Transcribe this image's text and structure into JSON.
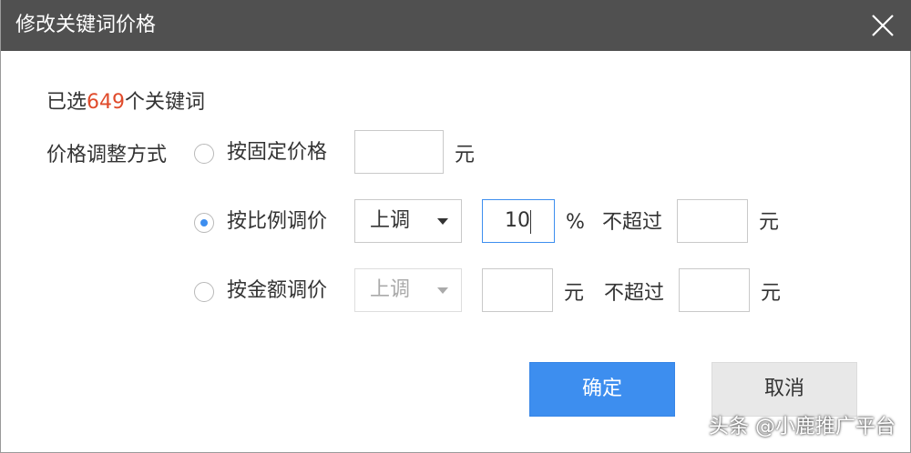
{
  "dialog": {
    "title": "修改关键词价格"
  },
  "selection": {
    "prefix": "已选",
    "count": "649",
    "suffix": "个关键词"
  },
  "method": {
    "label": "价格调整方式",
    "options": [
      {
        "label": "按固定价格",
        "selected": false,
        "value": "",
        "unit": "元"
      },
      {
        "label": "按比例调价",
        "selected": true,
        "direction": "上调",
        "value": "10",
        "unit": "%",
        "limit_label": "不超过",
        "limit_value": "",
        "limit_unit": "元"
      },
      {
        "label": "按金额调价",
        "selected": false,
        "direction": "上调",
        "value": "",
        "unit": "元",
        "limit_label": "不超过",
        "limit_value": "",
        "limit_unit": "元"
      }
    ]
  },
  "buttons": {
    "confirm": "确定",
    "cancel": "取消"
  },
  "watermark": "头条 @小鹿推广平台",
  "colors": {
    "titlebar": "#505050",
    "primary": "#3d8eef",
    "count": "#e04b2b"
  }
}
